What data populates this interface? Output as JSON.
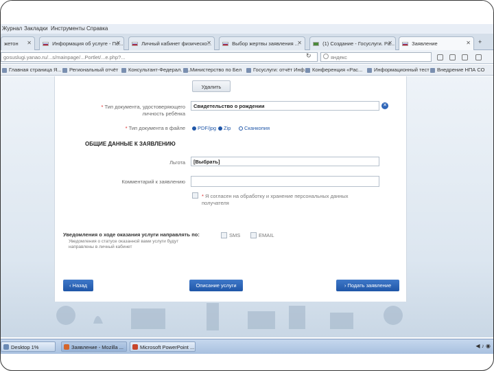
{
  "menubar": {
    "items": [
      "Журнал",
      "Закладки",
      "Инструменты",
      "Справка"
    ]
  },
  "tabs": [
    {
      "label": "жетон",
      "active": false
    },
    {
      "label": "Информация об услуге - По...",
      "active": false
    },
    {
      "label": "Личный кабинет физическо...",
      "active": false
    },
    {
      "label": "Выбор жертвы заявления ...",
      "active": false
    },
    {
      "label": "(1) Создание - Госуслуги. Ра...",
      "active": false
    },
    {
      "label": "Заявление",
      "active": true
    }
  ],
  "urlbar": {
    "url": "gosuslugi.yanao.ru/...s/mainpage/...Portlet/...e.php?...",
    "search_placeholder": "яндекс"
  },
  "bookmarks": [
    "Главная страница Я...",
    "Региональный отчёт",
    "Консультант-Федерал. п...",
    "Министерство по Бел",
    "Госуслуги: отчёт Инф...",
    "Конференция «Рас...",
    "Информационный тест",
    "Внедрение НПА СО"
  ],
  "form": {
    "delete_button": "Удалить",
    "doc_type_label": "Тип документа, удостоверяющего личность ребёнка",
    "doc_type_value": "Свидетельство о рождении",
    "file_type_label": "Тип документа в файле",
    "file_options": [
      "PDF/jpg",
      "Zip",
      "Сканкопия"
    ],
    "section_title": "ОБЩИЕ ДАННЫЕ К ЗАЯВЛЕНИЮ",
    "lgota_label": "Льгота",
    "lgota_value": "[Выбрать]",
    "comment_label": "Комментарий к заявлению",
    "comment_value": "",
    "consent_text_1": "Я согласен на обработку и хранение персональных данных",
    "consent_text_2": "получателя",
    "notify_title": "Уведомления о ходе оказания услуги направлять по:",
    "notify_sms": "SMS",
    "notify_email": "EMAIL",
    "notify_hint_1": "Уведомления о статусе оказанной вами услуги будут",
    "notify_hint_2": "направлены в личный кабинет",
    "back_button": "‹ Назад",
    "description_button": "Описание услуги",
    "submit_button": "› Подать заявление"
  },
  "taskbar": {
    "items": [
      {
        "label": "Desktop 1%",
        "active": false
      },
      {
        "label": "Заявление - Mozilla ...",
        "active": true
      },
      {
        "label": "Microsoft PowerPoint ...",
        "active": false
      }
    ],
    "tray": "◀ ♪ ◉"
  },
  "colors": {
    "accent_blue": "#1f56a8",
    "required_red": "#dd2222"
  }
}
